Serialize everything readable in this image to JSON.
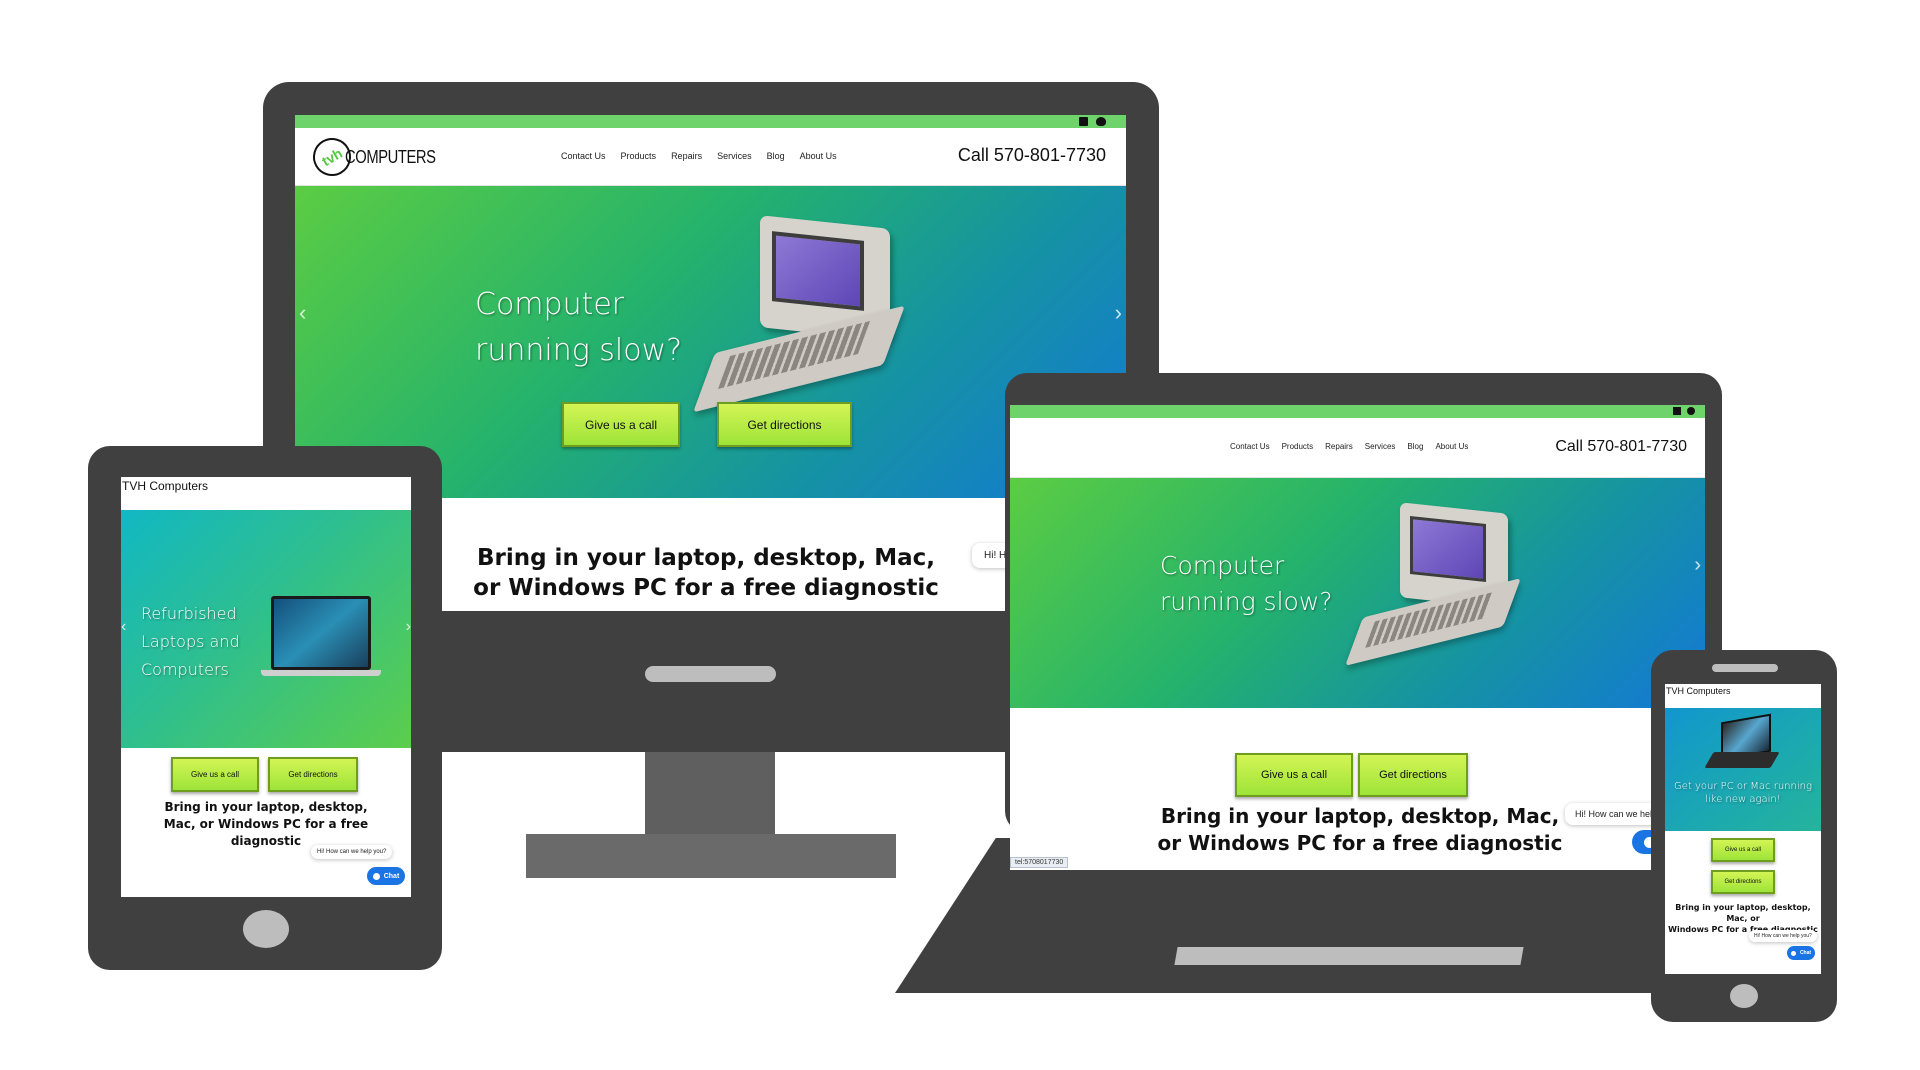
{
  "site": {
    "logo_mark": "tvh",
    "logo_word": "COMPUTERS",
    "tablet_title": "TVH Computers",
    "phone_title": "TVH Computers",
    "phone_number_label": "Call 570-801-7730",
    "nav": [
      "Contact Us",
      "Products",
      "Repairs",
      "Services",
      "Blog",
      "About Us"
    ],
    "social_icons": [
      "facebook-icon",
      "twitter-icon"
    ]
  },
  "hero": {
    "desktop_line1": "Computer",
    "desktop_line2": "running slow?",
    "tablet_lines": [
      "Refurbished",
      "Laptops and",
      "Computers"
    ],
    "phone_text": "Get your PC or Mac running like new again!",
    "prev_icon": "chevron-left-icon",
    "next_icon": "chevron-right-icon"
  },
  "actions": {
    "call_label": "Give us a call",
    "directions_label": "Get directions"
  },
  "tagline": {
    "desktop_line1": "Bring in your laptop, desktop, Mac,",
    "desktop_line2": "or Windows PC for a free diagnostic",
    "tablet_lines": [
      "Bring in your laptop, desktop,",
      "Mac, or Windows PC for a free",
      "diagnostic"
    ],
    "phone_lines": [
      "Bring in your laptop, desktop, Mac, or",
      "Windows PC for a free diagnostic"
    ]
  },
  "chat": {
    "greeting": "Hi! How can we help you?",
    "button_label": "Chat",
    "minimize_label": "–",
    "status_url": "tel:5708017730"
  },
  "colors": {
    "top_bar": "#6ed36b",
    "device_frame": "#404040",
    "button_top": "#d3f455",
    "button_bottom": "#9ee438",
    "chat_button": "#1b74e4"
  }
}
